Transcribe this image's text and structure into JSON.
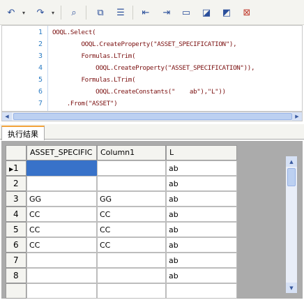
{
  "toolbar": {
    "buttons": [
      {
        "name": "undo-icon",
        "glyph": "↶"
      },
      {
        "name": "undo-dropdown-icon",
        "glyph": "▾"
      },
      {
        "name": "redo-icon",
        "glyph": "↷"
      },
      {
        "name": "redo-dropdown-icon",
        "glyph": "▾"
      },
      {
        "name": "find-icon",
        "glyph": "⌕"
      },
      {
        "name": "toggle-bookmark-icon",
        "glyph": "⧉"
      },
      {
        "name": "line-numbers-icon",
        "glyph": "☰"
      },
      {
        "name": "outdent-icon",
        "glyph": "⇤"
      },
      {
        "name": "indent-icon",
        "glyph": "⇥"
      },
      {
        "name": "comment-box-icon",
        "glyph": "▭"
      },
      {
        "name": "comment-out-icon",
        "glyph": "◪"
      },
      {
        "name": "uncomment-icon",
        "glyph": "◩"
      },
      {
        "name": "remove-comment-icon",
        "glyph": "⊠"
      }
    ]
  },
  "editor": {
    "line_numbers": [
      "1",
      "2",
      "3",
      "4",
      "5",
      "6",
      "7"
    ],
    "lines": [
      "OOQL.Select(",
      "        OOQL.CreateProperty(\"ASSET_SPECIFICATION\"),",
      "        Formulas.LTrim(",
      "            OOQL.CreateProperty(\"ASSET_SPECIFICATION\")),",
      "        Formulas.LTrim(",
      "            OOQL.CreateConstants(\"    ab\"),\"L\"))",
      "    .From(\"ASSET\")"
    ]
  },
  "tabs": [
    {
      "label": "执行结果"
    }
  ],
  "grid": {
    "columns": [
      "ASSET_SPECIFIC",
      "Column1",
      "L"
    ],
    "rows": [
      {
        "num": "1",
        "marker": "▶",
        "cells": [
          "",
          "",
          "ab"
        ]
      },
      {
        "num": "2",
        "marker": "",
        "cells": [
          "",
          "",
          "ab"
        ]
      },
      {
        "num": "3",
        "marker": "",
        "cells": [
          "GG",
          "GG",
          "ab"
        ]
      },
      {
        "num": "4",
        "marker": "",
        "cells": [
          "CC",
          "CC",
          "ab"
        ]
      },
      {
        "num": "5",
        "marker": "",
        "cells": [
          "CC",
          "CC",
          "ab"
        ]
      },
      {
        "num": "6",
        "marker": "",
        "cells": [
          "CC",
          "CC",
          "ab"
        ]
      },
      {
        "num": "7",
        "marker": "",
        "cells": [
          "",
          "",
          "ab"
        ]
      },
      {
        "num": "8",
        "marker": "",
        "cells": [
          "",
          "",
          "ab"
        ]
      }
    ],
    "selected_color": "#3872c9"
  }
}
